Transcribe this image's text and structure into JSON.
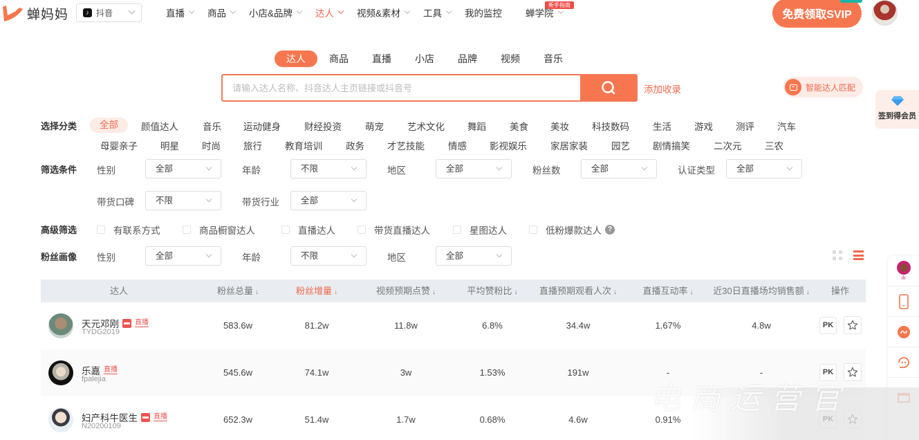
{
  "brand": {
    "name": "蝉妈妈",
    "accent": "#f6774f"
  },
  "platform_select": {
    "value": "抖音"
  },
  "nav": {
    "items": [
      {
        "label": "直播",
        "dropdown": true
      },
      {
        "label": "商品",
        "dropdown": true
      },
      {
        "label": "小店&品牌",
        "dropdown": true
      },
      {
        "label": "达人",
        "dropdown": true,
        "active": true
      },
      {
        "label": "视频&素材",
        "dropdown": true
      },
      {
        "label": "工具",
        "dropdown": true
      },
      {
        "label": "我的监控",
        "dropdown": false
      },
      {
        "label": "蝉学院",
        "dropdown": true,
        "badge": "新手指南"
      }
    ],
    "svip_button": "免费领取SVIP"
  },
  "search": {
    "tabs": [
      "达人",
      "商品",
      "直播",
      "小店",
      "品牌",
      "视频",
      "音乐"
    ],
    "active_tab": "达人",
    "placeholder": "请输入达人名称、抖音达人主页链接或抖音号",
    "value": "",
    "add_link": "添加收录",
    "ai_match": "智能达人匹配"
  },
  "signin": {
    "label": "签到得会员"
  },
  "filters": {
    "category": {
      "label": "选择分类",
      "items": [
        "全部",
        "颜值达人",
        "音乐",
        "运动健身",
        "财经投资",
        "萌宠",
        "艺术文化",
        "舞蹈",
        "美食",
        "美妆",
        "科技数码",
        "生活",
        "游戏",
        "测评",
        "汽车",
        "母婴亲子",
        "明星",
        "时尚",
        "旅行",
        "教育培训",
        "政务",
        "才艺技能",
        "情感",
        "影视娱乐",
        "家居家装",
        "园艺",
        "剧情搞笑",
        "二次元",
        "三农"
      ],
      "active": "全部"
    },
    "conditions": {
      "label": "筛选条件",
      "fields": [
        {
          "label": "性别",
          "value": "全部"
        },
        {
          "label": "年龄",
          "value": "不限"
        },
        {
          "label": "地区",
          "value": "全部"
        },
        {
          "label": "粉丝数",
          "value": "全部"
        },
        {
          "label": "认证类型",
          "value": "全部"
        },
        {
          "label": "带货口碑",
          "value": "不限"
        },
        {
          "label": "带货行业",
          "value": "全部"
        }
      ]
    },
    "advanced": {
      "label": "高级筛选",
      "options": [
        "有联系方式",
        "商品橱窗达人",
        "直播达人",
        "带货直播达人",
        "星图达人",
        "低粉爆款达人"
      ]
    },
    "fan_profile": {
      "label": "粉丝画像",
      "fields": [
        {
          "label": "性别",
          "value": "全部"
        },
        {
          "label": "年龄",
          "value": "不限"
        },
        {
          "label": "地区",
          "value": "全部"
        }
      ]
    }
  },
  "table": {
    "columns": [
      "达人",
      "粉丝总量",
      "粉丝增量",
      "视频预期点赞",
      "平均赞粉比",
      "直播预期观看人次",
      "直播互动率",
      "近30日直播场均销售额",
      "操作"
    ],
    "sorted_column": "粉丝增量",
    "rows": [
      {
        "name": "天元邓刚",
        "id": "TYDG2019",
        "shop": true,
        "live": "直播",
        "fans": "583.6w",
        "fans_growth": "81.2w",
        "video_likes": "11.8w",
        "like_fan_ratio": "6.8%",
        "live_views": "34.4w",
        "live_interaction": "1.67%",
        "live_sales_30d": "4.8w"
      },
      {
        "name": "乐嘉",
        "id": "fpalejia",
        "shop": false,
        "live": "直播",
        "fans": "545.6w",
        "fans_growth": "74.1w",
        "video_likes": "3w",
        "like_fan_ratio": "1.53%",
        "live_views": "191w",
        "live_interaction": "-",
        "live_sales_30d": "-"
      },
      {
        "name": "妇产科牛医生",
        "id": "N20200109",
        "shop": true,
        "live": "直播",
        "fans": "652.3w",
        "fans_growth": "51.4w",
        "video_likes": "1.7w",
        "like_fan_ratio": "0.68%",
        "live_views": "4.6w",
        "live_interaction": "0.91%",
        "live_sales_30d": ""
      }
    ],
    "action_pk": "PK"
  },
  "watermark": "电商运营官"
}
